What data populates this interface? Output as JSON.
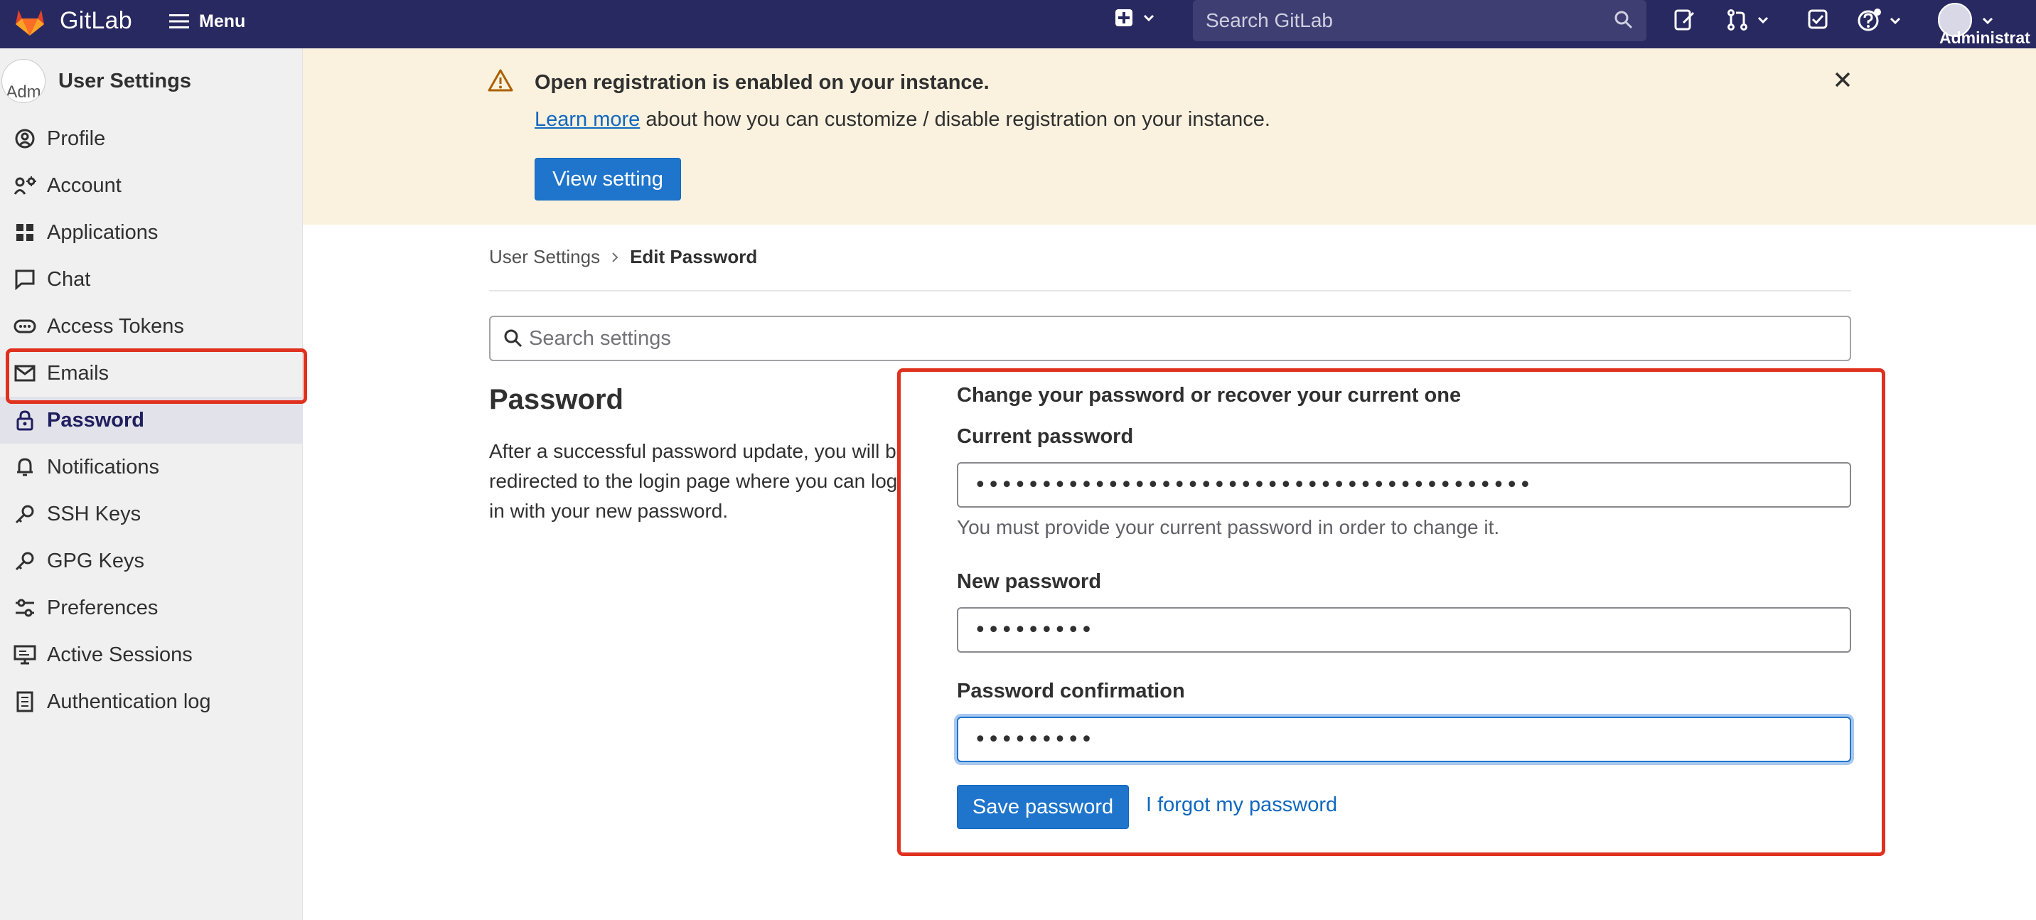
{
  "header": {
    "brand": "GitLab",
    "menu_label": "Menu",
    "search_placeholder": "Search GitLab",
    "user_label": "Administrat"
  },
  "sidebar": {
    "avatar_alt": "Adm",
    "title": "User Settings",
    "items": [
      {
        "label": "Profile",
        "icon": "profile-icon"
      },
      {
        "label": "Account",
        "icon": "account-icon"
      },
      {
        "label": "Applications",
        "icon": "applications-icon"
      },
      {
        "label": "Chat",
        "icon": "chat-icon"
      },
      {
        "label": "Access Tokens",
        "icon": "token-icon"
      },
      {
        "label": "Emails",
        "icon": "mail-icon"
      },
      {
        "label": "Password",
        "icon": "lock-icon",
        "active": true
      },
      {
        "label": "Notifications",
        "icon": "bell-icon"
      },
      {
        "label": "SSH Keys",
        "icon": "key-icon"
      },
      {
        "label": "GPG Keys",
        "icon": "key-icon"
      },
      {
        "label": "Preferences",
        "icon": "preferences-icon"
      },
      {
        "label": "Active Sessions",
        "icon": "monitor-icon"
      },
      {
        "label": "Authentication log",
        "icon": "log-icon"
      }
    ]
  },
  "banner": {
    "title": "Open registration is enabled on your instance.",
    "link": "Learn more",
    "body": " about how you can customize / disable registration on your instance.",
    "button": "View setting"
  },
  "breadcrumb": {
    "parent": "User Settings",
    "current": "Edit Password"
  },
  "settings_search": {
    "placeholder": "Search settings"
  },
  "section": {
    "title": "Password",
    "description": "After a successful password update, you will be redirected to the login page where you can log in with your new password."
  },
  "form": {
    "heading": "Change your password or recover your current one",
    "current_label": "Current password",
    "current_value": "••••••••••••••••••••••••••••••••••••••••••",
    "current_help": "You must provide your current password in order to change it.",
    "new_label": "New password",
    "new_value": "•••••••••",
    "confirm_label": "Password confirmation",
    "confirm_value": "•••••••••",
    "save_label": "Save password",
    "forgot_label": "I forgot my password"
  },
  "colors": {
    "navbar": "#292961",
    "primary": "#1f75cb",
    "banner": "#faf2df",
    "highlight": "#e0301e"
  }
}
